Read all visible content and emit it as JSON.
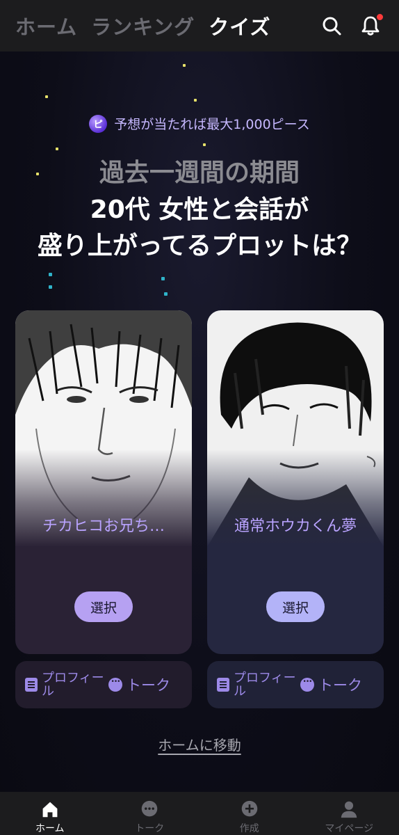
{
  "header": {
    "tabs": [
      {
        "label": "ホーム",
        "active": false
      },
      {
        "label": "ランキング",
        "active": false
      },
      {
        "label": "クイズ",
        "active": true
      }
    ],
    "icons": [
      "search-icon",
      "bell-icon"
    ],
    "notification_dot_color": "#ff3b3b"
  },
  "promo": {
    "text": "予想が当たれば最大1,000ピース",
    "coin_glyph": "ピ"
  },
  "question": {
    "line1": "過去一週間の期間",
    "line2": "20代 女性と会話が",
    "line3": "盛り上がってるプロットは？"
  },
  "cards": [
    {
      "name": "チカヒコお兄ち…",
      "select_label": "選択",
      "profile_label": "プロフィール",
      "talk_label": "トーク",
      "accent": "#b6a1f2"
    },
    {
      "name": "通常ホウカくん夢",
      "select_label": "選択",
      "profile_label": "プロフィール",
      "talk_label": "トーク",
      "accent": "#b3b3f8"
    }
  ],
  "home_link": "ホームに移動",
  "bottom_nav": [
    {
      "label": "ホーム",
      "icon": "home-icon",
      "active": true
    },
    {
      "label": "トーク",
      "icon": "chat-icon",
      "active": false
    },
    {
      "label": "作成",
      "icon": "plus-icon",
      "active": false
    },
    {
      "label": "マイページ",
      "icon": "user-icon",
      "active": false
    }
  ]
}
